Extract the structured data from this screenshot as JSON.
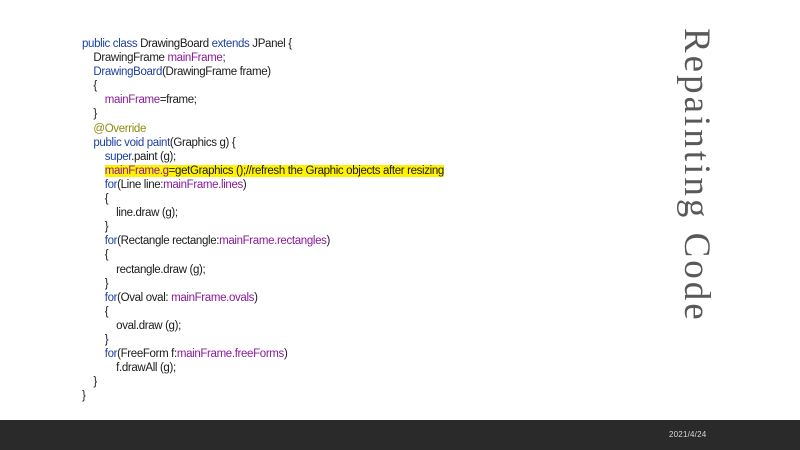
{
  "slide": {
    "title": "Repainting Code",
    "date": "2021/4/24"
  },
  "code": {
    "l1": {
      "kw1": "public class ",
      "name": "DrawingBoard ",
      "kw2": "extends ",
      "rest": "JPanel {"
    },
    "l2": {
      "type": "DrawingFrame ",
      "field": "mainFrame",
      "rest": ";"
    },
    "l3": {
      "ctor": "DrawingBoard",
      "rest": "(DrawingFrame frame)"
    },
    "l4": "{",
    "l5": {
      "field": "mainFrame",
      "rest": "=frame;"
    },
    "l6": "}",
    "l7": "@Override",
    "l8": {
      "kw": "public void ",
      "method": "paint",
      "rest": "(Graphics g) {"
    },
    "l9": {
      "kw": "super",
      "rest": ".paint (g);"
    },
    "l10": {
      "field": "mainFrame.g",
      "rest": "=getGraphics ();//refresh the Graphic objects after resizing"
    },
    "l11": {
      "kw": "for",
      "rest": "(Line line:",
      "field": "mainFrame.lines",
      "end": ")"
    },
    "l12": "{",
    "l13": "line.draw (g);",
    "l14": "}",
    "l15": {
      "kw": "for",
      "rest": "(Rectangle rectangle:",
      "field": "mainFrame.rectangles",
      "end": ")"
    },
    "l16": "{",
    "l17": "rectangle.draw (g);",
    "l18": "}",
    "l19": {
      "kw": "for",
      "rest": "(Oval oval: ",
      "field": "mainFrame.ovals",
      "end": ")"
    },
    "l20": "{",
    "l21": "oval.draw (g);",
    "l22": "}",
    "l23": {
      "kw": "for",
      "rest": "(FreeForm f:",
      "field": "mainFrame.freeForms",
      "end": ")"
    },
    "l24": "f.drawAll (g);",
    "l25": "}",
    "l26": "}"
  },
  "colors": {
    "keyword": "#1c3fa0",
    "field": "#8a1a9a",
    "annotation": "#8f8a10",
    "highlight": "#fff200",
    "footer_bg": "#2a2a2a"
  }
}
